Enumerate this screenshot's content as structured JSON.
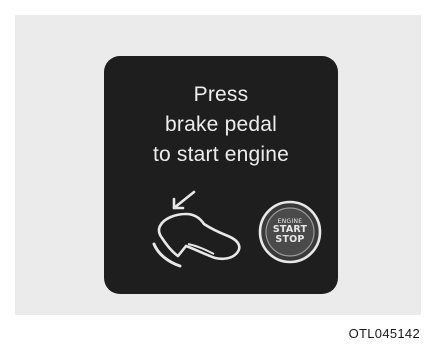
{
  "display": {
    "message_line1": "Press",
    "message_line2": "brake pedal",
    "message_line3": "to start engine"
  },
  "start_button": {
    "line1": "ENGINE",
    "line2": "START",
    "line3": "STOP"
  },
  "icons": {
    "pedal": "brake-pedal-icon",
    "button": "engine-start-stop-button-icon"
  },
  "colors": {
    "panel": "#1e1e1e",
    "frame": "#ebebeb",
    "text": "#ededed"
  },
  "figure_code": "OTL045142"
}
